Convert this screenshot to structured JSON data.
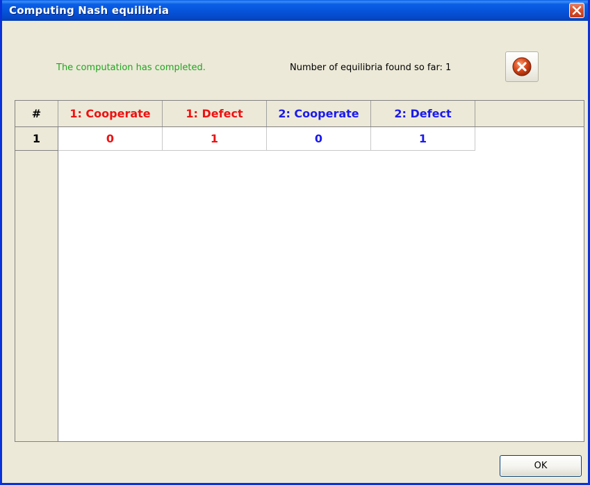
{
  "window": {
    "title": "Computing Nash equilibria"
  },
  "status": {
    "message": "The computation has completed.",
    "message_color": "#1fa51f",
    "count_label": "Number of equilibria found so far:",
    "count_value": "1"
  },
  "table": {
    "columns": [
      {
        "label": "#",
        "color": "#000000"
      },
      {
        "label": "1: Cooperate",
        "color": "#ee1111"
      },
      {
        "label": "1: Defect",
        "color": "#ee1111"
      },
      {
        "label": "2: Cooperate",
        "color": "#1a1aee"
      },
      {
        "label": "2: Defect",
        "color": "#1a1aee"
      }
    ],
    "rows": [
      {
        "index": "1",
        "cells": [
          "0",
          "1",
          "0",
          "1"
        ]
      }
    ]
  },
  "buttons": {
    "ok_label": "OK",
    "cancel_icon": "cancel-circle-icon",
    "close_icon": "close-icon"
  },
  "colors": {
    "player1": "#ee1111",
    "player2": "#1a1aee",
    "titlebar": "#0653d9",
    "dialog_bg": "#ece9d8"
  }
}
